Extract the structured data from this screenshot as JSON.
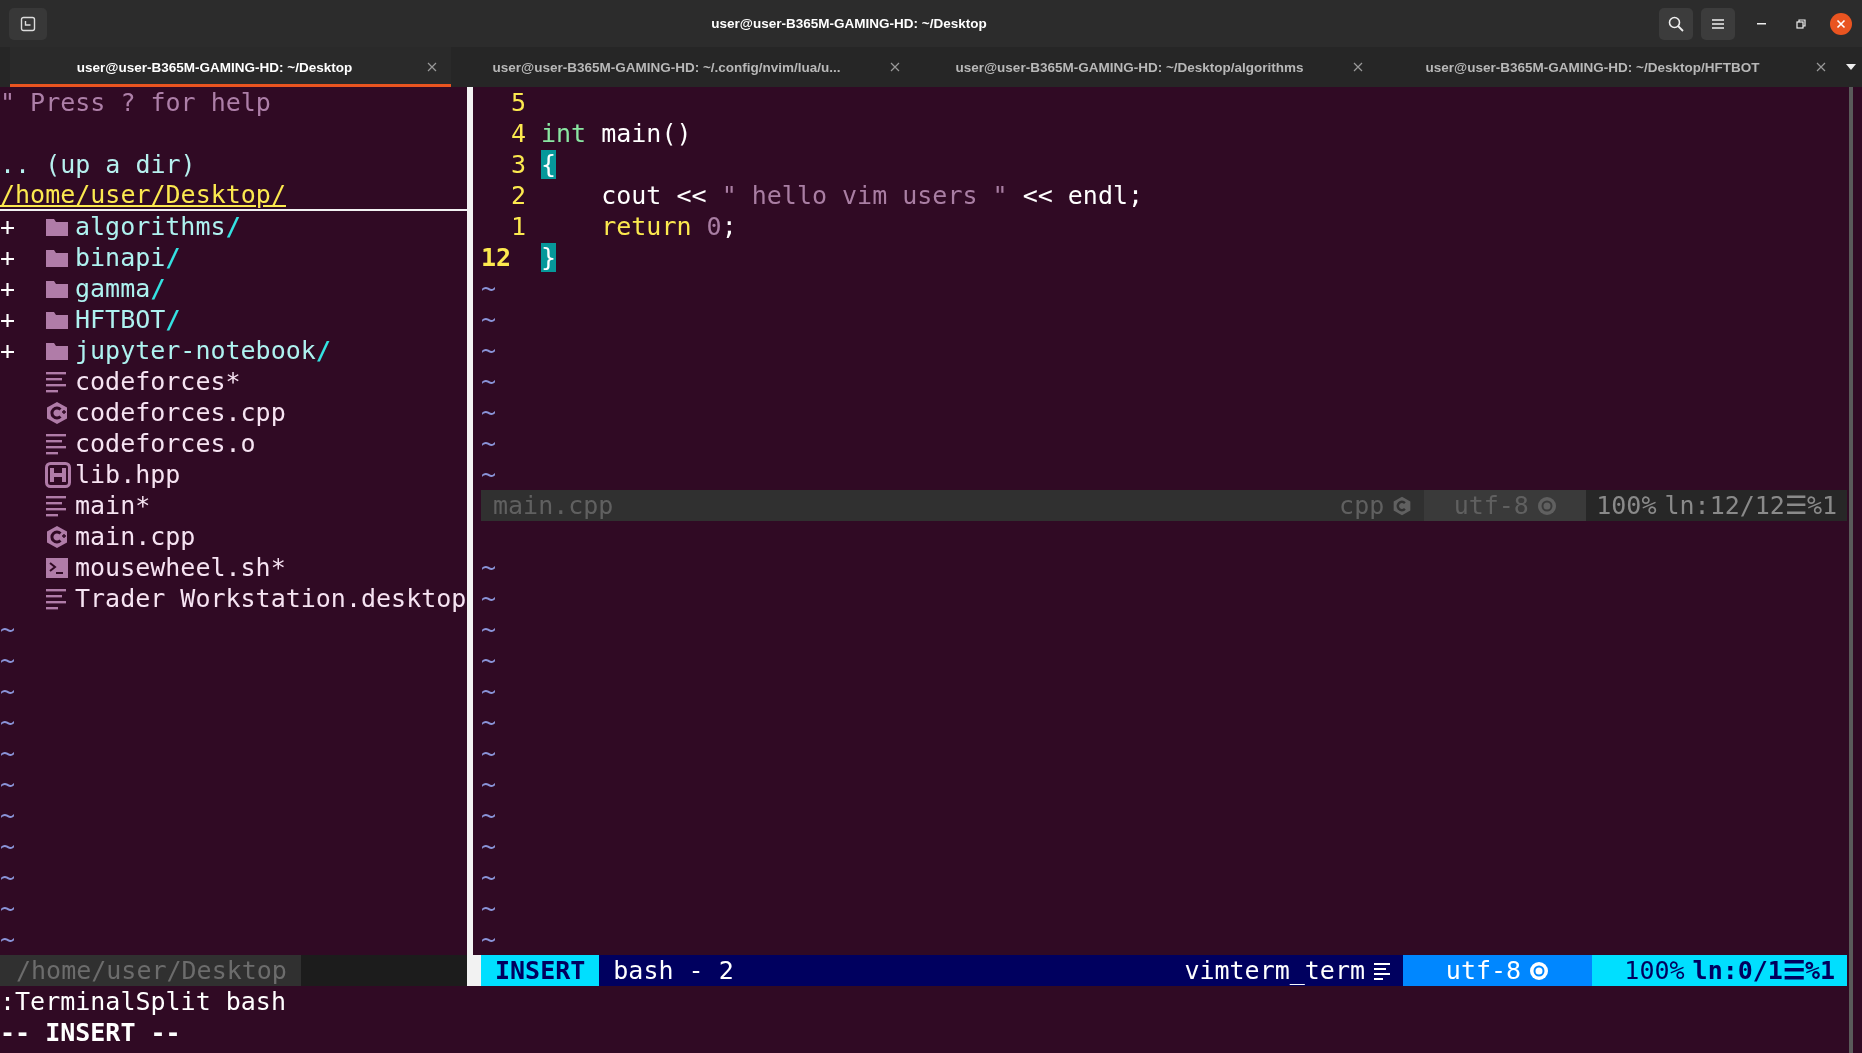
{
  "window": {
    "title": "user@user-B365M-GAMING-HD: ~/Desktop"
  },
  "tabs": [
    {
      "label": "user@user-B365M-GAMING-HD: ~/Desktop",
      "selected": true
    },
    {
      "label": "user@user-B365M-GAMING-HD: ~/.config/nvim/lua/u...",
      "selected": false
    },
    {
      "label": "user@user-B365M-GAMING-HD: ~/Desktop/algorithms",
      "selected": false
    },
    {
      "label": "user@user-B365M-GAMING-HD: ~/Desktop/HFTBOT",
      "selected": false
    }
  ],
  "file_tree": {
    "help": "\" Press ? for help",
    "parent": ".. (up a dir)",
    "path": "/home/user/Desktop/",
    "items": [
      {
        "kind": "folder",
        "marker": "+",
        "name": "algorithms",
        "slash": "/"
      },
      {
        "kind": "folder",
        "marker": "+",
        "name": "binapi",
        "slash": "/"
      },
      {
        "kind": "folder",
        "marker": "+",
        "name": "gamma",
        "slash": "/"
      },
      {
        "kind": "folder",
        "marker": "+",
        "name": "HFTBOT",
        "slash": "/"
      },
      {
        "kind": "folder",
        "marker": "+",
        "name": "jupyter-notebook",
        "slash": "/"
      },
      {
        "kind": "text",
        "name": "codeforces*"
      },
      {
        "kind": "cpp",
        "name": "codeforces.cpp"
      },
      {
        "kind": "text",
        "name": "codeforces.o"
      },
      {
        "kind": "header",
        "name": "lib.hpp"
      },
      {
        "kind": "text",
        "name": "main*"
      },
      {
        "kind": "cpp",
        "name": "main.cpp"
      },
      {
        "kind": "script",
        "name": "mousewheel.sh*"
      },
      {
        "kind": "text",
        "name": "Trader Workstation.desktop"
      }
    ],
    "filler": [
      "~",
      "~",
      "~",
      "~",
      "~",
      "~",
      "~",
      "~",
      "~",
      "~",
      "~"
    ]
  },
  "editor": {
    "lines": [
      {
        "number": "5",
        "current": false
      },
      {
        "number": "4",
        "current": false,
        "tokens": [
          {
            "kind": "type",
            "text": "int"
          },
          {
            "kind": "plain",
            "text": " main()"
          }
        ]
      },
      {
        "number": "3",
        "current": false,
        "tokens": [
          {
            "kind": "match",
            "text": "{"
          }
        ]
      },
      {
        "number": "2",
        "current": false,
        "tokens": [
          {
            "kind": "plain",
            "text": "    cout << "
          },
          {
            "kind": "string",
            "text": "\" hello vim users \""
          },
          {
            "kind": "plain",
            "text": " << endl;"
          }
        ]
      },
      {
        "number": "1",
        "current": false,
        "tokens": [
          {
            "kind": "keyword",
            "text": "    return"
          },
          {
            "kind": "number",
            "text": " 0"
          },
          {
            "kind": "plain",
            "text": ";"
          }
        ]
      },
      {
        "number": "12",
        "current": true,
        "tokens": [
          {
            "kind": "match",
            "text": "}"
          }
        ]
      }
    ],
    "filler": [
      "~",
      "~",
      "~",
      "~",
      "~",
      "~",
      "~"
    ],
    "status": {
      "file": "main.cpp",
      "filetype": "cpp",
      "encoding": "utf-8",
      "percent": "100%",
      "position": "ln:12/12☰%1"
    }
  },
  "terminal": {
    "filler": [
      "~",
      "~",
      "~",
      "~",
      "~",
      "~",
      "~",
      "~",
      "~",
      "~",
      "~",
      "~",
      "~"
    ],
    "status": {
      "mode": "INSERT",
      "name": "bash - 2",
      "filetype": "vimterm_term",
      "encoding": "utf-8",
      "percent": "100%",
      "position": "ln:0/1☰%1"
    }
  },
  "tree_status": {
    "path": "/home/user/Desktop"
  },
  "command_line": {
    "command": ":TerminalSplit bash",
    "mode": "-- INSERT --"
  }
}
